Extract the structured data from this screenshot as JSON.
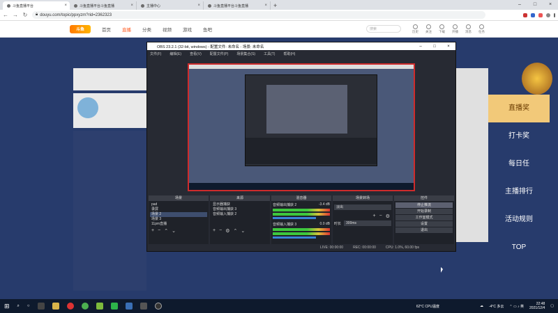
{
  "browser": {
    "tabs": [
      {
        "label": "斗鱼直播平台"
      },
      {
        "label": "斗鱼直播平台斗鱼直播"
      },
      {
        "label": "主播中心"
      },
      {
        "label": "斗鱼直播平台斗鱼直播"
      }
    ],
    "url": "douyu.com/topic/ppxyzm?rid=2362323"
  },
  "site": {
    "logo": "斗鱼",
    "nav": [
      "首页",
      "直播",
      "分类",
      "视频",
      "游戏",
      "鱼吧"
    ],
    "search_placeholder": "搜索",
    "icons": [
      "历史",
      "关注",
      "下载",
      "开播",
      "消息",
      "任务"
    ]
  },
  "right_nav": [
    "直播奖",
    "打卡奖",
    "每日任",
    "主播排行",
    "活动规则",
    "TOP"
  ],
  "obs": {
    "title": "OBS 23.2.1 (32-bit, windows) - 配置文件: 未命名 - 场景: 未命名",
    "menu": [
      "文件(F)",
      "编辑(E)",
      "查看(V)",
      "配置文件(P)",
      "场景集合(S)",
      "工具(T)",
      "帮助(H)"
    ],
    "docks": {
      "scenes": {
        "title": "场景",
        "items": [
          "pad",
          "录屏",
          "场景 2",
          "场景 3",
          "11pm直播"
        ],
        "selected": 2
      },
      "sources": {
        "title": "来源",
        "items": [
          "显示器捕获",
          "音频输出捕获 3",
          "音频输入捕获 2"
        ]
      },
      "mixer": {
        "title": "混音器",
        "channels": [
          {
            "name": "音频输出捕获 2",
            "db": "-3.4 dB"
          },
          {
            "name": "音频输入捕获 3",
            "db": "0.0 dB"
          }
        ]
      },
      "transitions": {
        "title": "场景转场",
        "type": "淡出",
        "duration_label": "时长",
        "duration": "300ms"
      },
      "controls": {
        "title": "控件",
        "buttons": [
          "停止推流",
          "开始录制",
          "工作室模式",
          "设置",
          "退出"
        ]
      }
    },
    "status": [
      "LIVE: 00:00:00",
      "REC: 00:00:00",
      "CPU: 1.0%, 60.00 fps"
    ]
  },
  "taskbar": {
    "weather": "-4°C 多云",
    "cpu": "62°C CPU温度",
    "time": "22:48",
    "date": "2021/12/4"
  }
}
